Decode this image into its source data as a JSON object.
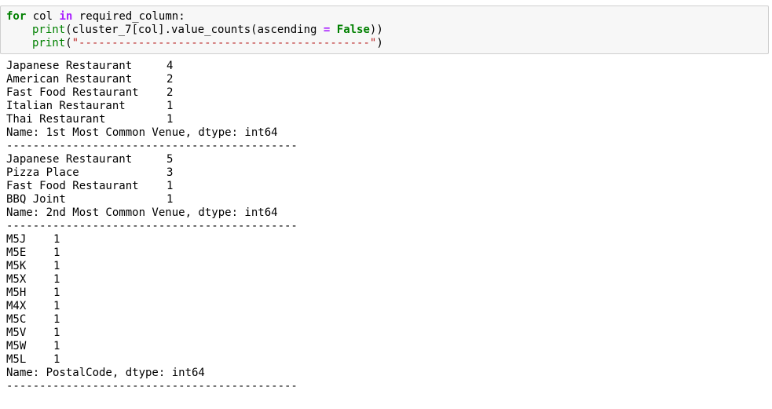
{
  "code": {
    "line1": {
      "kw_for": "for",
      "var": "col",
      "kw_in": "in",
      "iter": "required_column:"
    },
    "line2": {
      "fn": "print",
      "args_pre": "(cluster_7[col].value_counts(ascending ",
      "eq": "=",
      "space": " ",
      "const": "False",
      "args_post": "))"
    },
    "line3": {
      "fn": "print",
      "open": "(",
      "str": "\"--------------------------------------------\"",
      "close": ")"
    }
  },
  "output": {
    "block1": {
      "rows": [
        {
          "label": "Japanese Restaurant",
          "value": "4"
        },
        {
          "label": "American Restaurant",
          "value": "2"
        },
        {
          "label": "Fast Food Restaurant",
          "value": "2"
        },
        {
          "label": "Italian Restaurant",
          "value": "1"
        },
        {
          "label": "Thai Restaurant",
          "value": "1"
        }
      ],
      "footer": "Name: 1st Most Common Venue, dtype: int64",
      "separator": "--------------------------------------------"
    },
    "block2": {
      "rows": [
        {
          "label": "Japanese Restaurant",
          "value": "5"
        },
        {
          "label": "Pizza Place",
          "value": "3"
        },
        {
          "label": "Fast Food Restaurant",
          "value": "1"
        },
        {
          "label": "BBQ Joint",
          "value": "1"
        }
      ],
      "footer": "Name: 2nd Most Common Venue, dtype: int64",
      "separator": "--------------------------------------------"
    },
    "block3": {
      "rows": [
        {
          "label": "M5J",
          "value": "1"
        },
        {
          "label": "M5E",
          "value": "1"
        },
        {
          "label": "M5K",
          "value": "1"
        },
        {
          "label": "M5X",
          "value": "1"
        },
        {
          "label": "M5H",
          "value": "1"
        },
        {
          "label": "M4X",
          "value": "1"
        },
        {
          "label": "M5C",
          "value": "1"
        },
        {
          "label": "M5V",
          "value": "1"
        },
        {
          "label": "M5W",
          "value": "1"
        },
        {
          "label": "M5L",
          "value": "1"
        }
      ],
      "footer": "Name: PostalCode, dtype: int64",
      "separator": "--------------------------------------------"
    }
  }
}
